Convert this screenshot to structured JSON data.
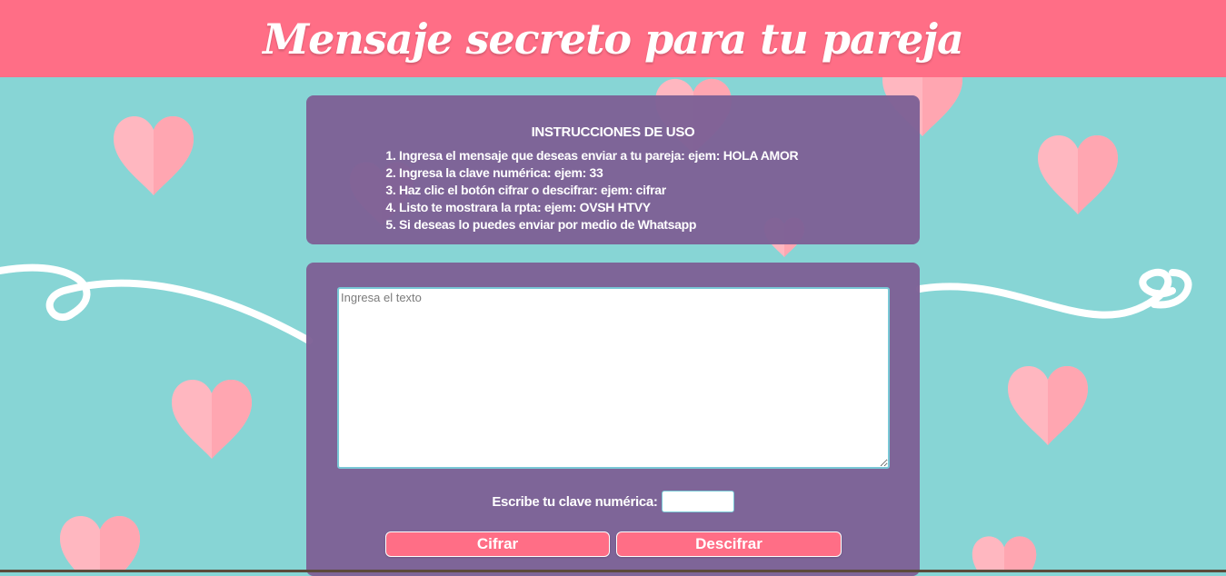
{
  "header": {
    "title": "Mensaje secreto para tu pareja"
  },
  "colors": {
    "header_bg": "#ff6e86",
    "background": "#87d5d5",
    "panel": "#7e6196",
    "heart": "#ffb7c0"
  },
  "instructions": {
    "title": "INSTRUCCIONES DE USO",
    "steps": [
      {
        "text": "Ingresa el mensaje que deseas enviar a tu pareja: ",
        "example": "ejem: HOLA AMOR"
      },
      {
        "text": "Ingresa la clave numérica: ",
        "example": "ejem: 33"
      },
      {
        "text": "Haz clic el botón cifrar o descifrar: ",
        "example": "ejem: cifrar"
      },
      {
        "text": "Listo te mostrara la rpta: ",
        "example": "ejem: OVSH HTVY"
      },
      {
        "text": "Si deseas lo puedes enviar por medio de Whatsapp",
        "example": ""
      }
    ]
  },
  "form": {
    "message_placeholder": "Ingresa el texto",
    "message_value": "",
    "key_label": "Escribe tu clave numérica:",
    "key_value": "",
    "cifrar_label": "Cifrar",
    "descifrar_label": "Descifrar"
  },
  "icons": [
    "heart-icon",
    "swirl-decoration"
  ]
}
